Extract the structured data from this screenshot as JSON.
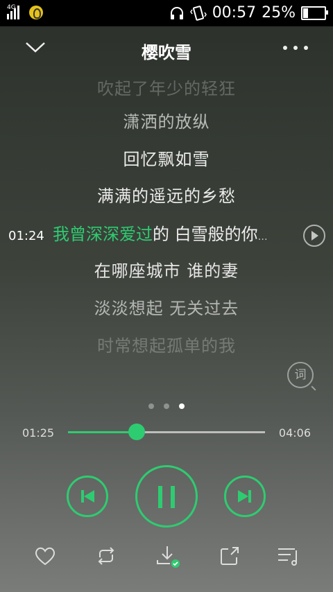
{
  "status": {
    "network": "4G",
    "time": "00:57",
    "battery": "25%",
    "battery_level": 0.25
  },
  "header": {
    "title": "樱吹雪"
  },
  "lyrics": {
    "faded_top": "吹起了年少的轻狂",
    "line1": "潇洒的放纵",
    "line2": "回忆飘如雪",
    "line3": "满满的遥远的乡愁",
    "current_time": "01:24",
    "current_highlight": "我曾深深爱过",
    "current_rest": "的 白雪般的你",
    "current_ellipsis": "…",
    "line5": "在哪座城市 谁的妻",
    "line6": "淡淡想起  无关过去",
    "faded_bottom": "时常想起孤单的我"
  },
  "lyric_button": {
    "label": "词"
  },
  "page_dots": {
    "count": 3,
    "active_index": 2
  },
  "progress": {
    "elapsed": "01:25",
    "total": "04:06",
    "fraction": 0.35
  },
  "colors": {
    "accent": "#2ecc71",
    "background_top": "#2b2f2a",
    "background_bottom": "#7a7c79"
  },
  "controls": {
    "prev_icon": "skip-previous-icon",
    "play_icon": "pause-icon",
    "next_icon": "skip-next-icon"
  },
  "bottom_bar": {
    "icons": [
      "heart-icon",
      "repeat-icon",
      "download-icon",
      "share-icon",
      "playlist-icon"
    ]
  }
}
